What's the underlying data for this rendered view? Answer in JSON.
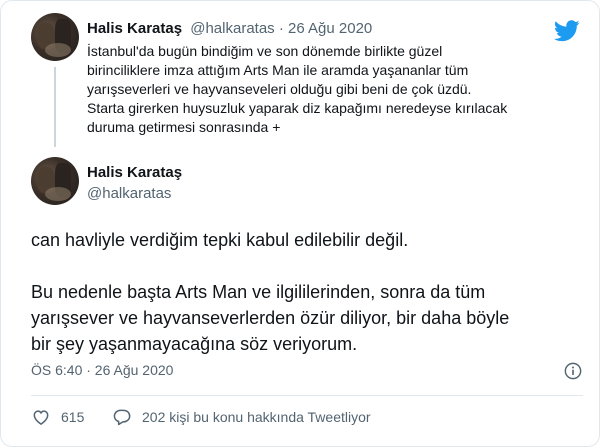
{
  "tweet_parent": {
    "author_name": "Halis Karataş",
    "author_handle": "@halkaratas",
    "separator": "·",
    "date": "26 Ağu 2020",
    "text": "İstanbul'da bugün bindiğim ve son dönemde birlikte güzel\nbirinciliklere imza attığım Arts Man ile aramda yaşananlar tüm\nyarışseverleri ve hayvanseveleri olduğu gibi beni de çok üzdü.\nStarta girerken huysuzluk yaparak diz kapağımı neredeyse kırılacak\nduruma getirmesi sonrasında +"
  },
  "tweet_main": {
    "author_name": "Halis Karataş",
    "author_handle": "@halkaratas",
    "text": "can havliyle verdiğim tepki kabul edilebilir değil.\n\nBu nedenle başta Arts Man ve ilgililerinden, sonra da tüm\nyarışsever ve hayvanseverlerden özür diliyor,  bir daha böyle\nbir şey yaşanmayacağına söz veriyorum.",
    "timestamp": "ÖS 6:40 · 26 Ağu 2020"
  },
  "actions": {
    "like_count": "615",
    "reply_text": "202 kişi bu konu hakkında Tweetliyor"
  },
  "icons": {
    "brand": "twitter-bird-icon",
    "info": "info-icon",
    "like": "heart-icon",
    "reply": "reply-bubble-icon"
  },
  "colors": {
    "twitter_blue": "#1d9bf0",
    "muted": "#536471",
    "text": "#0f1419",
    "border": "#e1e8ed"
  }
}
